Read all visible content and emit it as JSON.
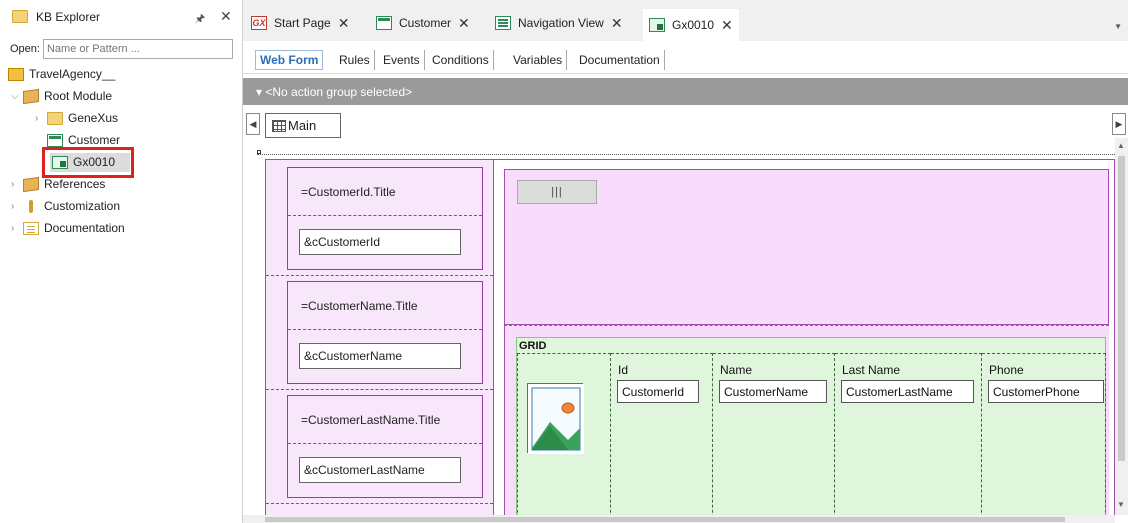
{
  "kb_explorer": {
    "title": "KB Explorer",
    "open_label": "Open:",
    "open_placeholder": "Name or Pattern ...",
    "tree": {
      "root": "TravelAgency__",
      "root_module": "Root Module",
      "genexus": "GeneXus",
      "customer": "Customer",
      "gx0010": "Gx0010",
      "references": "References",
      "customization": "Customization",
      "documentation": "Documentation"
    }
  },
  "tabs": [
    {
      "label": "Start Page",
      "icon": "gx-logo-icon",
      "close": "✕"
    },
    {
      "label": "Customer",
      "icon": "transaction-icon",
      "close": "✕"
    },
    {
      "label": "Navigation View",
      "icon": "navigation-view-icon",
      "close": "✕"
    },
    {
      "label": "Gx0010",
      "icon": "webpanel-icon",
      "close": "✕",
      "active": true
    }
  ],
  "subtabs": [
    "Web Form",
    "Rules",
    "Events",
    "Conditions",
    "Variables",
    "Documentation"
  ],
  "action_group": "▾ <No action group selected>",
  "main_label": "Main",
  "form": {
    "filters": [
      {
        "title": "=CustomerId.Title",
        "field": "&cCustomerId"
      },
      {
        "title": "=CustomerName.Title",
        "field": "&cCustomerName"
      },
      {
        "title": "=CustomerLastName.Title",
        "field": "&cCustomerLastName"
      }
    ],
    "toggle_button": "|||",
    "grid": {
      "label": "GRID",
      "columns": [
        {
          "header": "Id",
          "cell": "CustomerId"
        },
        {
          "header": "Name",
          "cell": "CustomerName"
        },
        {
          "header": "Last Name",
          "cell": "CustomerLastName"
        },
        {
          "header": "Phone",
          "cell": "CustomerPhone"
        }
      ]
    }
  },
  "colors": {
    "selection_highlight": "#e0201c",
    "active_subtab": "#2a6fb8",
    "form_region": "#f8e6fb",
    "grid_region": "#dff5dc"
  }
}
